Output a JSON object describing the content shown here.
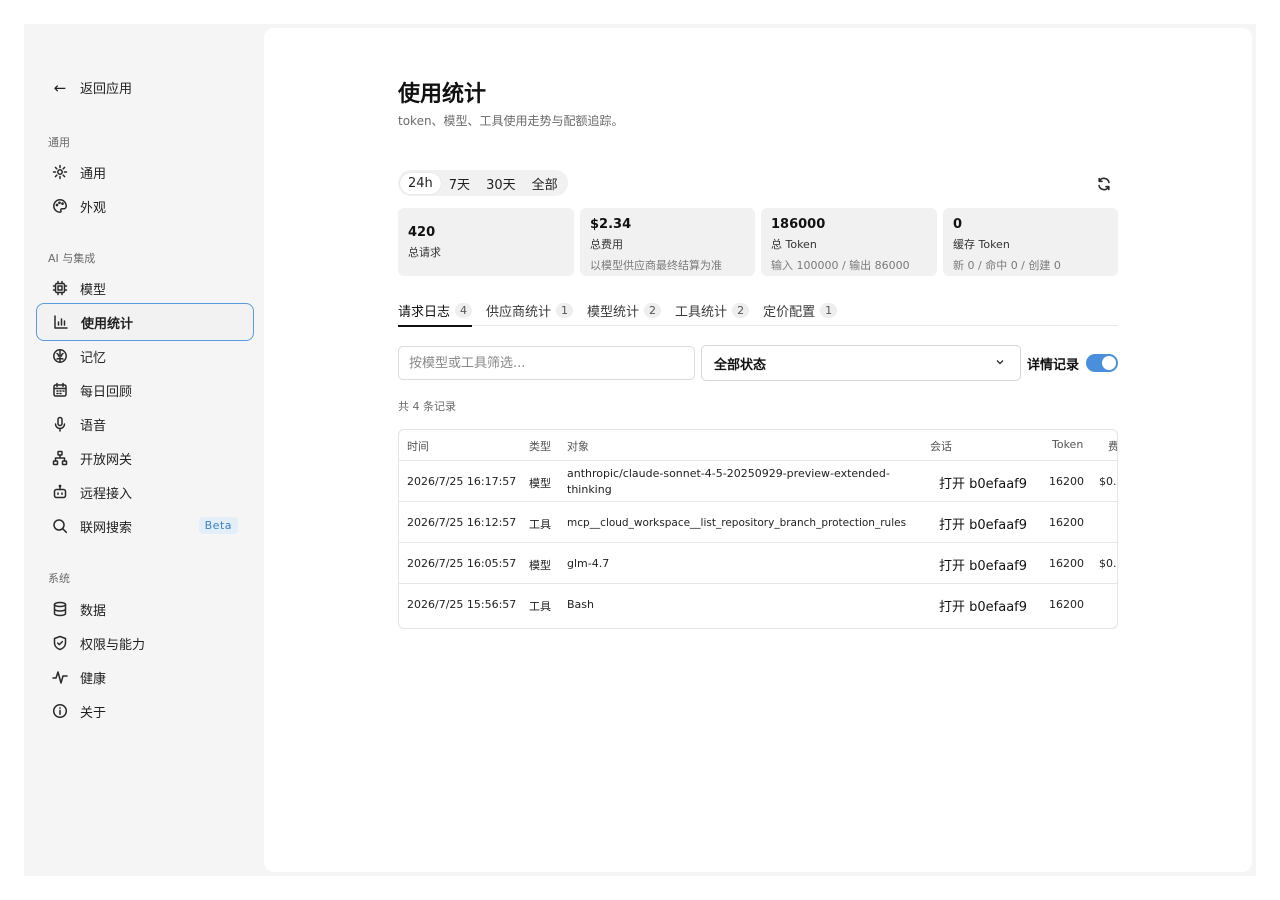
{
  "sidebar": {
    "back_label": "返回应用",
    "groups": [
      {
        "label": "通用"
      },
      {
        "label": "AI 与集成"
      },
      {
        "label": "系统"
      }
    ],
    "items": [
      {
        "label": "通用",
        "icon": "gear-icon"
      },
      {
        "label": "外观",
        "icon": "palette-icon"
      },
      {
        "label": "模型",
        "icon": "chip-icon"
      },
      {
        "label": "使用统计",
        "icon": "bar-chart-icon",
        "active": true
      },
      {
        "label": "记忆",
        "icon": "brain-icon"
      },
      {
        "label": "每日回顾",
        "icon": "calendar-icon"
      },
      {
        "label": "语音",
        "icon": "microphone-icon"
      },
      {
        "label": "开放网关",
        "icon": "network-icon"
      },
      {
        "label": "远程接入",
        "icon": "robot-icon"
      },
      {
        "label": "联网搜索",
        "icon": "search-icon",
        "badge": "Beta"
      },
      {
        "label": "数据",
        "icon": "database-icon"
      },
      {
        "label": "权限与能力",
        "icon": "shield-icon"
      },
      {
        "label": "健康",
        "icon": "pulse-icon"
      },
      {
        "label": "关于",
        "icon": "info-icon"
      }
    ]
  },
  "header": {
    "title": "使用统计",
    "subtitle": "token、模型、工具使用走势与配额追踪。"
  },
  "range_tabs": [
    "24h",
    "7天",
    "30天",
    "全部"
  ],
  "range_selected": "24h",
  "stats": [
    {
      "value": "420",
      "label": "总请求",
      "sub": ""
    },
    {
      "value": "$2.34",
      "label": "总费用",
      "sub": "以模型供应商最终结算为准"
    },
    {
      "value": "186000",
      "label": "总 Token",
      "sub": "输入 100000 / 输出 86000"
    },
    {
      "value": "0",
      "label": "缓存 Token",
      "sub": "新 0 / 命中 0 / 创建 0"
    }
  ],
  "tabs": [
    {
      "label": "请求日志",
      "count": "4"
    },
    {
      "label": "供应商统计",
      "count": "1"
    },
    {
      "label": "模型统计",
      "count": "2"
    },
    {
      "label": "工具统计",
      "count": "2"
    },
    {
      "label": "定价配置",
      "count": "1"
    }
  ],
  "filters": {
    "search_placeholder": "按模型或工具筛选...",
    "status_value": "全部状态",
    "detail_label": "详情记录",
    "detail_enabled": true
  },
  "count_text": "共 4 条记录",
  "table": {
    "headers": [
      "时间",
      "类型",
      "对象",
      "会话",
      "Token",
      "费"
    ],
    "rows": [
      {
        "time": "2026/7/25 16:17:57",
        "type": "模型",
        "object": "anthropic/claude-sonnet-4-5-20250929-preview-extended-thinking",
        "session": "打开 b0efaaf9",
        "token": "16200",
        "cost": "$0.."
      },
      {
        "time": "2026/7/25 16:12:57",
        "type": "工具",
        "object": "mcp__cloud_workspace__list_repository_branch_protection_rules",
        "session": "打开 b0efaaf9",
        "token": "16200",
        "cost": ""
      },
      {
        "time": "2026/7/25 16:05:57",
        "type": "模型",
        "object": "glm-4.7",
        "session": "打开 b0efaaf9",
        "token": "16200",
        "cost": "$0.."
      },
      {
        "time": "2026/7/25 15:56:57",
        "type": "工具",
        "object": "Bash",
        "session": "打开 b0efaaf9",
        "token": "16200",
        "cost": ""
      }
    ]
  },
  "colors": {
    "accent": "#4a8fdb",
    "active_border": "#5a9be0",
    "sidebar_bg": "#f5f5f5"
  }
}
